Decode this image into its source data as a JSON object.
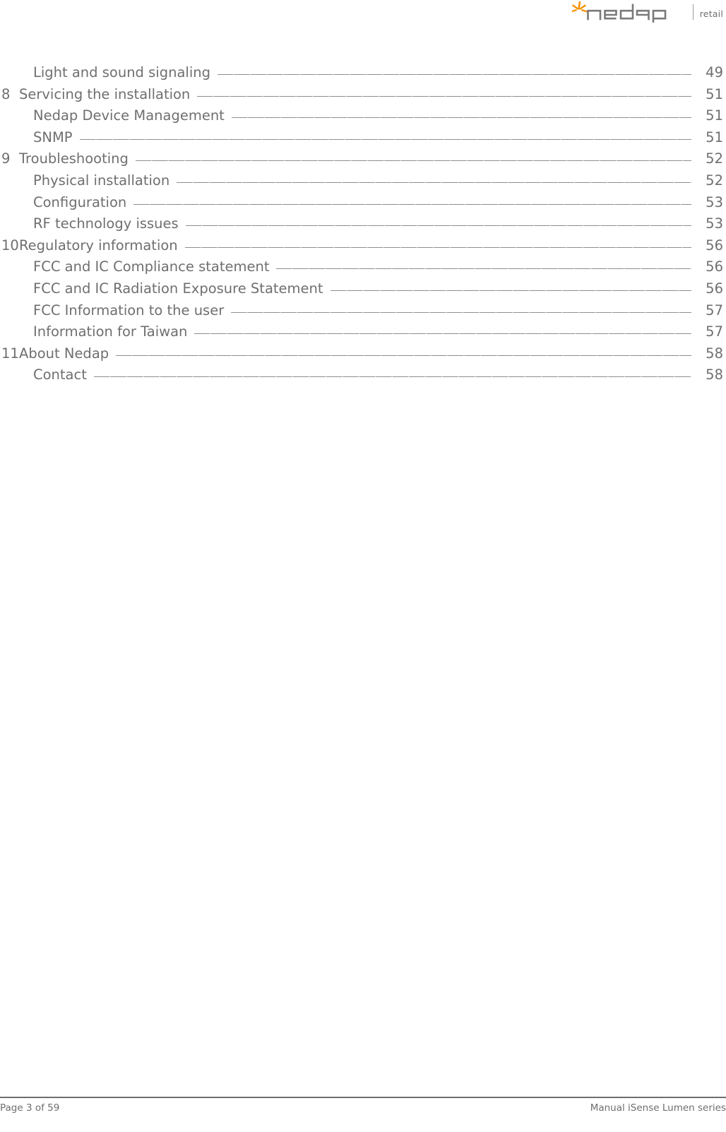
{
  "header": {
    "logo": {
      "brand": "nedap",
      "division": "retail",
      "star_color": "#F39200",
      "wordmark_color": "#7A7A7A"
    }
  },
  "toc": {
    "entries": [
      {
        "number": "",
        "title": "Light and sound signaling",
        "page": "49",
        "level": 2
      },
      {
        "number": "8",
        "title": "Servicing the installation",
        "page": "51",
        "level": 1
      },
      {
        "number": "",
        "title": "Nedap Device Management",
        "page": "51",
        "level": 2
      },
      {
        "number": "",
        "title": "SNMP",
        "page": "51",
        "level": 2
      },
      {
        "number": "9",
        "title": "Troubleshooting",
        "page": "52",
        "level": 1
      },
      {
        "number": "",
        "title": "Physical installation",
        "page": "52",
        "level": 2
      },
      {
        "number": "",
        "title": "Configuration",
        "page": "53",
        "level": 2
      },
      {
        "number": "",
        "title": "RF technology issues",
        "page": "53",
        "level": 2
      },
      {
        "number": "10",
        "title": "Regulatory information",
        "page": "56",
        "level": 1
      },
      {
        "number": "",
        "title": "FCC and IC Compliance statement",
        "page": "56",
        "level": 2
      },
      {
        "number": "",
        "title": "FCC and IC Radiation Exposure Statement",
        "page": "56",
        "level": 2
      },
      {
        "number": "",
        "title": "FCC Information to the user",
        "page": "57",
        "level": 2
      },
      {
        "number": "",
        "title": "Information for Taiwan",
        "page": "57",
        "level": 2
      },
      {
        "number": "11",
        "title": "About Nedap",
        "page": "58",
        "level": 1
      },
      {
        "number": "",
        "title": "Contact",
        "page": "58",
        "level": 2
      }
    ]
  },
  "footer": {
    "page_label": "Page 3 of 59",
    "document_title": "Manual iSense Lumen series"
  },
  "colors": {
    "text": "#6f6f6f",
    "leader": "#8e8e8e",
    "rule": "#6f6f6f",
    "accent": "#F39200"
  }
}
